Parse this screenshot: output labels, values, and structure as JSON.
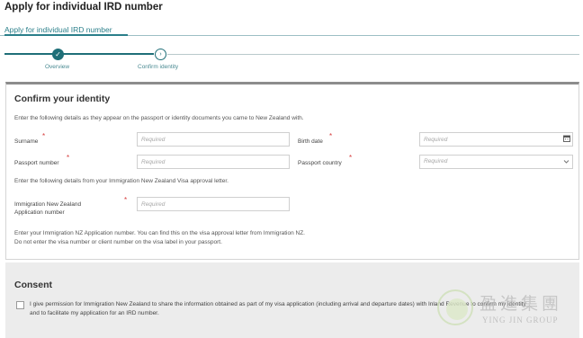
{
  "page": {
    "title": "Apply for individual IRD number"
  },
  "top_nav": {
    "link": "Apply for individual IRD number"
  },
  "stepper": {
    "steps": [
      {
        "label": "Overview",
        "icon": "check-icon",
        "state": "done",
        "glyph": "✓"
      },
      {
        "label": "Confirm identity",
        "icon": "chevron-right-icon",
        "state": "active",
        "glyph": "›"
      }
    ]
  },
  "identity": {
    "title": "Confirm your identity",
    "intro": "Enter the following details as they appear on the passport or identity documents you came to New Zealand with.",
    "required_mark": "*",
    "fields": {
      "surname": {
        "label": "Surname",
        "placeholder": "Required"
      },
      "birth_date": {
        "label": "Birth date",
        "placeholder": "Required",
        "icon": "calendar-icon"
      },
      "passport_number": {
        "label": "Passport number",
        "placeholder": "Required"
      },
      "passport_country": {
        "label": "Passport country",
        "placeholder": "Required",
        "icon": "chevron-down-icon"
      },
      "inz_number": {
        "label_line1": "Immigration New Zealand",
        "label_line2": "Application number",
        "placeholder": "Required"
      }
    },
    "visa_intro": "Enter the following details from your Immigration New Zealand Visa approval letter.",
    "inz_help_line1": "Enter your Immigration NZ Application number. You can find this on the visa approval letter from Immigration NZ.",
    "inz_help_line2": "Do not enter the visa number or client number on the visa label in your passport."
  },
  "consent": {
    "title": "Consent",
    "text": "I give permission for Immigration New Zealand to share the information obtained as part of my visa application (including arrival and departure dates) with Inland Revenue to confirm my identity and to facilitate my application for an IRD number."
  },
  "watermark": {
    "cn": "盈進集團",
    "en": "YING JIN GROUP"
  },
  "colors": {
    "accent": "#1f6f78",
    "link": "#2a7f8a",
    "required": "#d63b3b",
    "consent_bg": "#ececec"
  }
}
